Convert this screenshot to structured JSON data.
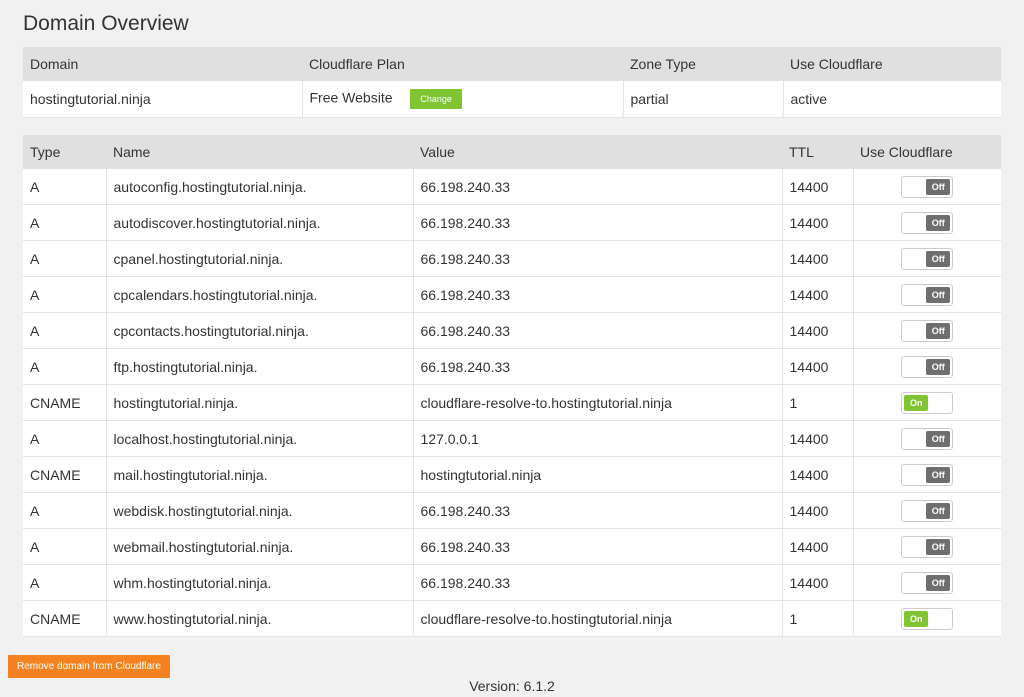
{
  "page_title": "Domain Overview",
  "overview": {
    "headers": [
      "Domain",
      "Cloudflare Plan",
      "Zone Type",
      "Use Cloudflare"
    ],
    "domain": "hostingtutorial.ninja",
    "plan": "Free Website",
    "change_label": "Change",
    "zone_type": "partial",
    "use_cloudflare": "active"
  },
  "records": {
    "headers": [
      "Type",
      "Name",
      "Value",
      "TTL",
      "Use Cloudflare"
    ],
    "rows": [
      {
        "type": "A",
        "name": "autoconfig.hostingtutorial.ninja.",
        "value": "66.198.240.33",
        "ttl": "14400",
        "toggle": "Off"
      },
      {
        "type": "A",
        "name": "autodiscover.hostingtutorial.ninja.",
        "value": "66.198.240.33",
        "ttl": "14400",
        "toggle": "Off"
      },
      {
        "type": "A",
        "name": "cpanel.hostingtutorial.ninja.",
        "value": "66.198.240.33",
        "ttl": "14400",
        "toggle": "Off"
      },
      {
        "type": "A",
        "name": "cpcalendars.hostingtutorial.ninja.",
        "value": "66.198.240.33",
        "ttl": "14400",
        "toggle": "Off"
      },
      {
        "type": "A",
        "name": "cpcontacts.hostingtutorial.ninja.",
        "value": "66.198.240.33",
        "ttl": "14400",
        "toggle": "Off"
      },
      {
        "type": "A",
        "name": "ftp.hostingtutorial.ninja.",
        "value": "66.198.240.33",
        "ttl": "14400",
        "toggle": "Off"
      },
      {
        "type": "CNAME",
        "name": "hostingtutorial.ninja.",
        "value": "cloudflare-resolve-to.hostingtutorial.ninja",
        "ttl": "1",
        "toggle": "On"
      },
      {
        "type": "A",
        "name": "localhost.hostingtutorial.ninja.",
        "value": "127.0.0.1",
        "ttl": "14400",
        "toggle": "Off"
      },
      {
        "type": "CNAME",
        "name": "mail.hostingtutorial.ninja.",
        "value": "hostingtutorial.ninja",
        "ttl": "14400",
        "toggle": "Off"
      },
      {
        "type": "A",
        "name": "webdisk.hostingtutorial.ninja.",
        "value": "66.198.240.33",
        "ttl": "14400",
        "toggle": "Off"
      },
      {
        "type": "A",
        "name": "webmail.hostingtutorial.ninja.",
        "value": "66.198.240.33",
        "ttl": "14400",
        "toggle": "Off"
      },
      {
        "type": "A",
        "name": "whm.hostingtutorial.ninja.",
        "value": "66.198.240.33",
        "ttl": "14400",
        "toggle": "Off"
      },
      {
        "type": "CNAME",
        "name": "www.hostingtutorial.ninja.",
        "value": "cloudflare-resolve-to.hostingtutorial.ninja",
        "ttl": "1",
        "toggle": "On"
      }
    ]
  },
  "remove_button_label": "Remove domain from Cloudflare",
  "version": "Version: 6.1.2",
  "colors": {
    "accent_green": "#7fc531",
    "toggle_off": "#6e6e6e",
    "remove_orange": "#f58220"
  }
}
